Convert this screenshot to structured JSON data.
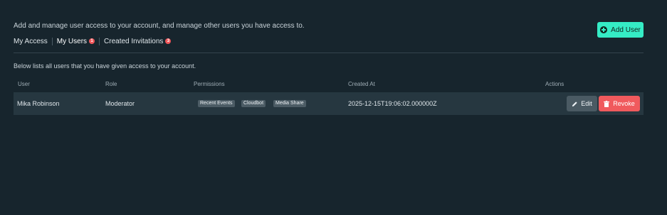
{
  "header": {
    "description": "Add and manage user access to your account, and manage other users you have access to.",
    "add_user_label": "Add User"
  },
  "tabs": [
    {
      "label": "My Access",
      "badge": null,
      "active": false
    },
    {
      "label": "My Users",
      "badge": "1",
      "active": true
    },
    {
      "label": "Created Invitations",
      "badge": "3",
      "active": false
    }
  ],
  "section": {
    "description": "Below lists all users that you have given access to your account."
  },
  "table": {
    "columns": [
      "User",
      "Role",
      "Permissions",
      "Created At",
      "Actions"
    ],
    "rows": [
      {
        "user": "Mika Robinson",
        "role": "Moderator",
        "permissions": [
          "Recent Events",
          "Cloudbot",
          "Media Share"
        ],
        "created_at": "2025-12-15T19:06:02.000000Z",
        "edit_label": "Edit",
        "revoke_label": "Revoke"
      }
    ]
  },
  "colors": {
    "background": "#17252d",
    "accent": "#35ecc5",
    "danger": "#f05a5d",
    "badge": "#f0575a"
  },
  "icons": {
    "add_user": "plus-circle-icon",
    "edit": "pencil-icon",
    "revoke": "trash-icon"
  }
}
